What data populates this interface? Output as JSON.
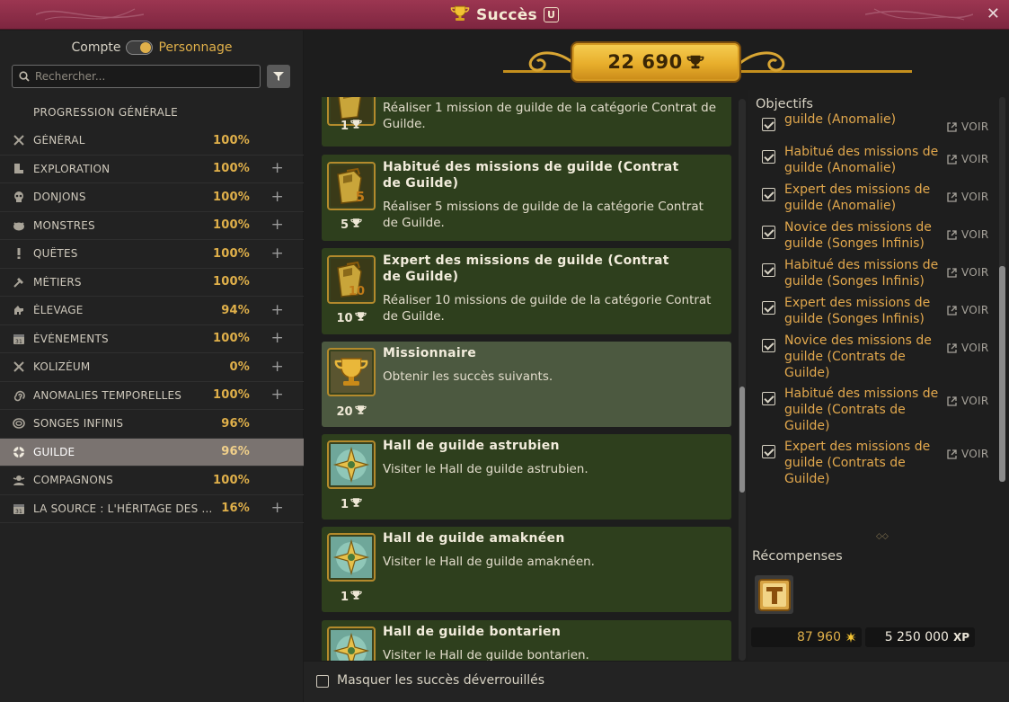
{
  "window": {
    "title": "Succès",
    "shortcut_key": "U",
    "close_glyph": "✕"
  },
  "sidebar": {
    "toggle": {
      "left_label": "Compte",
      "right_label": "Personnage",
      "selected": "Personnage"
    },
    "search": {
      "placeholder": "Rechercher..."
    },
    "progression_header": "PROGRESSION GÉNÉRALE",
    "categories": [
      {
        "name": "GÉNÉRAL",
        "percent": "100%",
        "expandable": false,
        "icon": "crossed-swords-icon"
      },
      {
        "name": "EXPLORATION",
        "percent": "100%",
        "expandable": true,
        "icon": "boot-icon"
      },
      {
        "name": "DONJONS",
        "percent": "100%",
        "expandable": true,
        "icon": "skull-icon"
      },
      {
        "name": "MONSTRES",
        "percent": "100%",
        "expandable": true,
        "icon": "monster-icon"
      },
      {
        "name": "QUÊTES",
        "percent": "100%",
        "expandable": true,
        "icon": "exclamation-icon"
      },
      {
        "name": "MÉTIERS",
        "percent": "100%",
        "expandable": false,
        "icon": "hammer-icon"
      },
      {
        "name": "ÉLEVAGE",
        "percent": "94%",
        "expandable": true,
        "icon": "mount-icon"
      },
      {
        "name": "ÉVÉNEMENTS",
        "percent": "100%",
        "expandable": true,
        "icon": "calendar-icon"
      },
      {
        "name": "KOLIZÉUM",
        "percent": "0%",
        "expandable": true,
        "icon": "crossed-swords-icon"
      },
      {
        "name": "ANOMALIES TEMPORELLES",
        "percent": "100%",
        "expandable": true,
        "icon": "spiral-icon"
      },
      {
        "name": "SONGES INFINIS",
        "percent": "96%",
        "expandable": false,
        "icon": "swirl-icon"
      },
      {
        "name": "GUILDE",
        "percent": "96%",
        "expandable": false,
        "icon": "guild-icon",
        "active": true
      },
      {
        "name": "COMPAGNONS",
        "percent": "100%",
        "expandable": false,
        "icon": "companion-icon"
      },
      {
        "name": "LA SOURCE : L'HÉRITAGE DES DO...",
        "percent": "16%",
        "expandable": true,
        "icon": "calendar-icon"
      }
    ]
  },
  "header": {
    "total_points": "22 690"
  },
  "achievements": [
    {
      "title": "",
      "description": "Réaliser 1 mission de guilde de la catégorie Contrat de Guilde.",
      "points": "1",
      "icon": "guild-mission-icon",
      "selected": false
    },
    {
      "title": "Habitué des missions de guilde (Contrat de Guilde)",
      "description": "Réaliser 5 missions de guilde de la catégorie Contrat de Guilde.",
      "points": "5",
      "icon": "guild-mission-icon",
      "badge": "5",
      "selected": false
    },
    {
      "title": "Expert des missions de guilde (Contrat de Guilde)",
      "description": "Réaliser 10 missions de guilde de la catégorie Contrat de Guilde.",
      "points": "10",
      "icon": "guild-mission-icon",
      "badge": "10",
      "selected": false
    },
    {
      "title": "Missionnaire",
      "description": "Obtenir les succès suivants.",
      "points": "20",
      "icon": "trophy-icon",
      "selected": true
    },
    {
      "title": "Hall de guilde astrubien",
      "description": "Visiter le Hall de guilde astrubien.",
      "points": "1",
      "icon": "compass-icon",
      "selected": false
    },
    {
      "title": "Hall de guilde amaknéen",
      "description": "Visiter le Hall de guilde amaknéen.",
      "points": "1",
      "icon": "compass-icon",
      "selected": false
    },
    {
      "title": "Hall de guilde bontarien",
      "description": "Visiter le Hall de guilde bontarien.",
      "points": "",
      "icon": "compass-icon",
      "selected": false
    }
  ],
  "details": {
    "objectives_title": "Objectifs",
    "objectives": [
      {
        "text": "guilde (Anomalie)",
        "done": true,
        "partial": true
      },
      {
        "text": "Habitué des missions de guilde (Anomalie)",
        "done": true
      },
      {
        "text": "Expert des missions de guilde (Anomalie)",
        "done": true
      },
      {
        "text": "Novice des missions de guilde (Songes Infinis)",
        "done": true
      },
      {
        "text": "Habitué des missions de guilde (Songes Infinis)",
        "done": true
      },
      {
        "text": "Expert des missions de guilde (Songes Infinis)",
        "done": true
      },
      {
        "text": "Novice des missions de guilde (Contrats de Guilde)",
        "done": true
      },
      {
        "text": "Habitué des missions de guilde (Contrats de Guilde)",
        "done": true
      },
      {
        "text": "Expert des missions de guilde (Contrats de Guilde)",
        "done": true
      }
    ],
    "voir_label": "VOIR",
    "rewards_title": "Récompenses",
    "reward_item_icon": "title-scroll-icon",
    "kamas": "87 960",
    "xp": "5 250 000",
    "xp_label": "XP"
  },
  "footer": {
    "hide_unlocked_label": "Masquer les succès déverrouillés",
    "checked": false
  },
  "colors": {
    "accent_gold": "#e0b04a",
    "card_green": "#2e3f1d",
    "card_selected": "#4c5940",
    "titlebar": "#8c2d48"
  }
}
